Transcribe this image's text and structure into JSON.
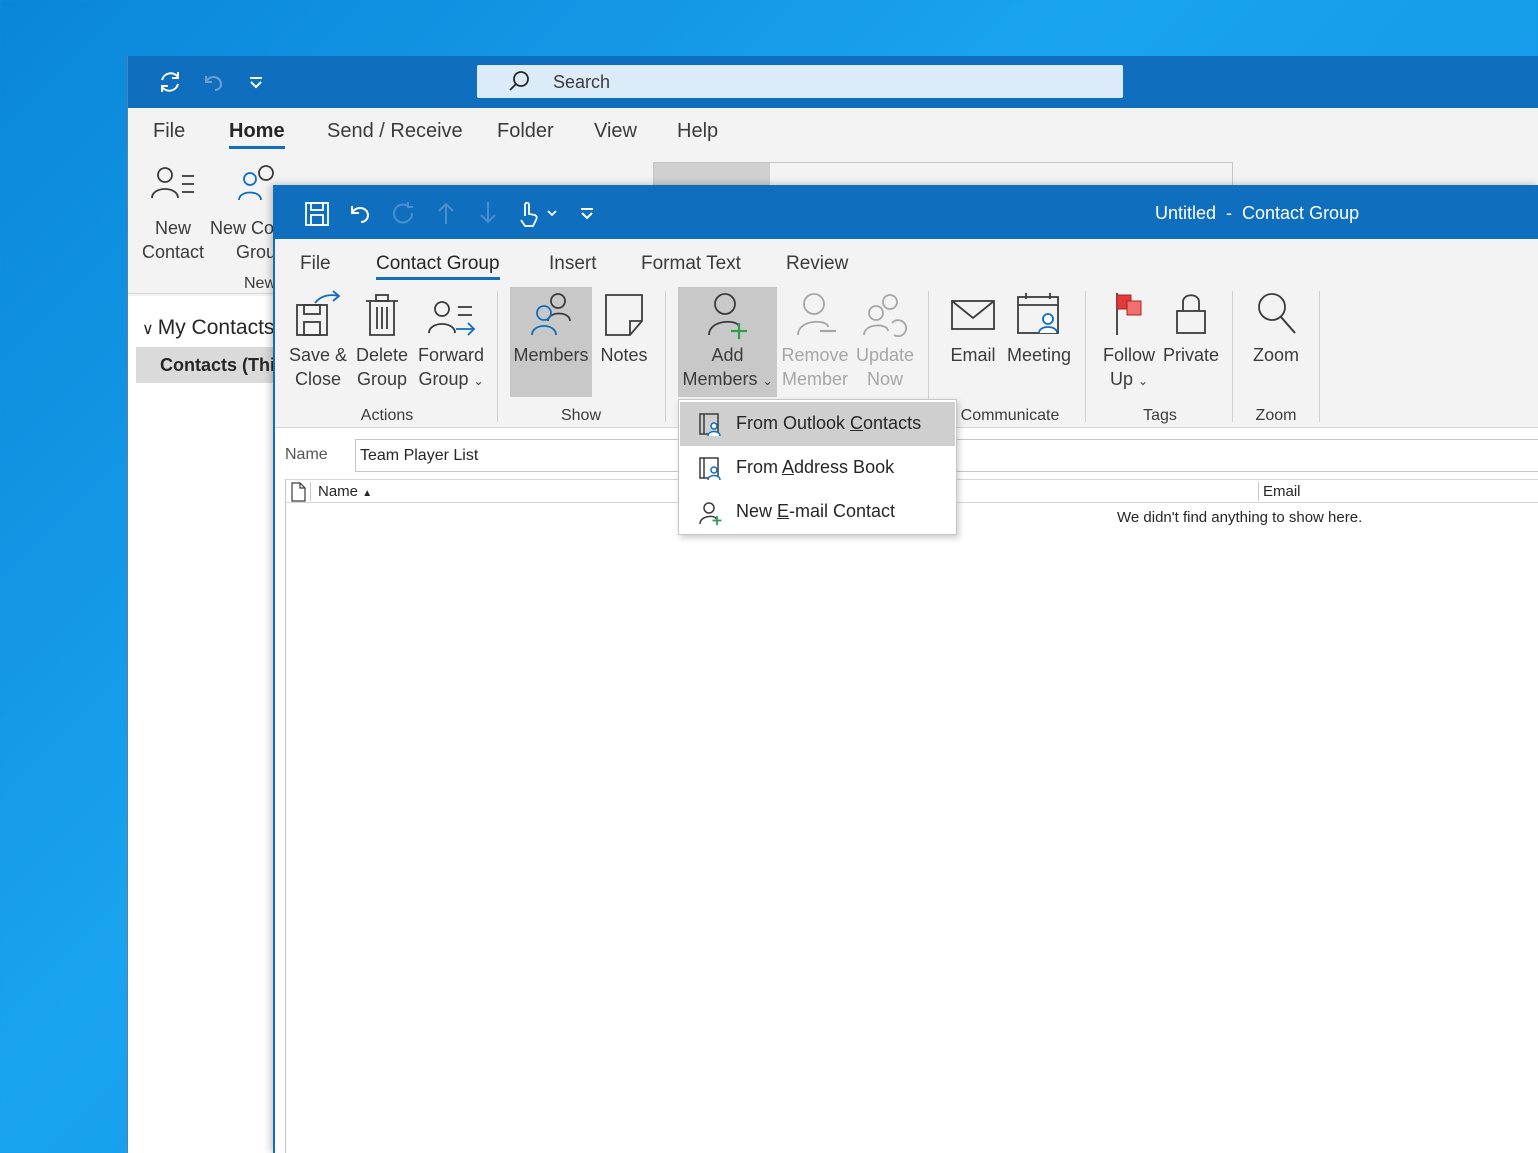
{
  "main_window": {
    "search_placeholder": "Search",
    "tabs": [
      "File",
      "Home",
      "Send / Receive",
      "Folder",
      "View",
      "Help"
    ],
    "active_tab": "Home",
    "ribbon": {
      "new_contact_line1": "New",
      "new_contact_line2": "Contact",
      "new_group_line1": "New Co",
      "new_group_line2": "Grou",
      "group_label": "New"
    },
    "nav": {
      "my_contacts": "My Contacts",
      "contacts_item": "Contacts (Thi"
    }
  },
  "contact_group_window": {
    "title": "Untitled  -  Contact Group",
    "tabs": [
      "File",
      "Contact Group",
      "Insert",
      "Format Text",
      "Review"
    ],
    "active_tab": "Contact Group",
    "ribbon": {
      "save_close_line1": "Save &",
      "save_close_line2": "Close",
      "delete_group_line1": "Delete",
      "delete_group_line2": "Group",
      "forward_group_line1": "Forward",
      "forward_group_line2": "Group",
      "actions_label": "Actions",
      "members_label": "Members",
      "notes_label": "Notes",
      "show_label": "Show",
      "add_members_line1": "Add",
      "add_members_line2": "Members",
      "remove_member_line1": "Remove",
      "remove_member_line2": "Member",
      "update_now_line1": "Update",
      "update_now_line2": "Now",
      "email_label": "Email",
      "meeting_label": "Meeting",
      "communicate_label": "Communicate",
      "follow_up_line1": "Follow",
      "follow_up_line2": "Up",
      "private_label": "Private",
      "tags_label": "Tags",
      "zoom_button_label": "Zoom",
      "zoom_group_label": "Zoom"
    },
    "name_label": "Name",
    "name_value": "Team Player List",
    "columns": {
      "name": "Name",
      "email": "Email"
    },
    "empty_message": "We didn't find anything to show here."
  },
  "dropdown": {
    "items": [
      {
        "before": "From Outlook ",
        "mnemonic": "C",
        "after": "ontacts"
      },
      {
        "before": "From ",
        "mnemonic": "A",
        "after": "ddress Book"
      },
      {
        "before": "New ",
        "mnemonic": "E",
        "after": "-mail Contact"
      }
    ]
  },
  "colors": {
    "accent": "#106ebe",
    "search_bg": "#dcebf8",
    "ribbon_bg": "#f3f3f3",
    "selected_bg": "#c8c8c8",
    "flag_red": "#e03a3a",
    "add_green": "#2e9e4a"
  }
}
